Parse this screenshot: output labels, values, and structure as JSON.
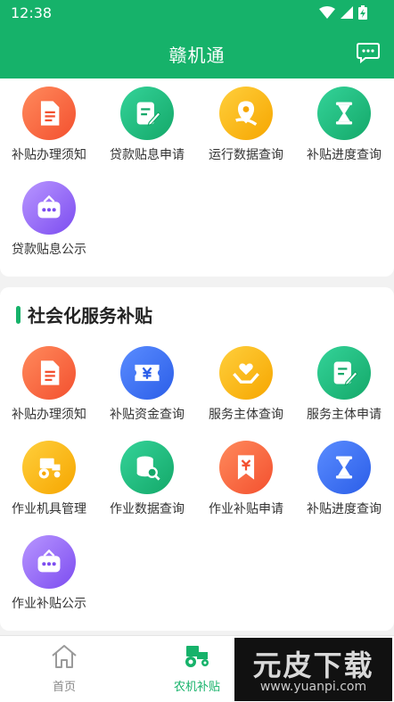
{
  "status_bar": {
    "time": "12:38"
  },
  "header": {
    "title": "赣机通"
  },
  "section1": {
    "items": [
      {
        "label": "补贴办理须知",
        "icon": "document-icon",
        "color": "orange"
      },
      {
        "label": "贷款贴息申请",
        "icon": "edit-form-icon",
        "color": "green"
      },
      {
        "label": "运行数据查询",
        "icon": "location-pin-icon",
        "color": "yellow"
      },
      {
        "label": "补贴进度查询",
        "icon": "hourglass-icon",
        "color": "green"
      },
      {
        "label": "贷款贴息公示",
        "icon": "notice-board-icon",
        "color": "purple"
      }
    ]
  },
  "section2": {
    "title": "社会化服务补贴",
    "items": [
      {
        "label": "补贴办理须知",
        "icon": "document-icon",
        "color": "orange"
      },
      {
        "label": "补贴资金查询",
        "icon": "yuan-ticket-icon",
        "color": "blue"
      },
      {
        "label": "服务主体查询",
        "icon": "heart-hands-icon",
        "color": "yellow"
      },
      {
        "label": "服务主体申请",
        "icon": "edit-form-icon",
        "color": "green"
      },
      {
        "label": "作业机具管理",
        "icon": "tractor-icon",
        "color": "yellow"
      },
      {
        "label": "作业数据查询",
        "icon": "database-search-icon",
        "color": "green"
      },
      {
        "label": "作业补贴申请",
        "icon": "yuan-bookmark-icon",
        "color": "orange"
      },
      {
        "label": "补贴进度查询",
        "icon": "hourglass-icon",
        "color": "blue"
      },
      {
        "label": "作业补贴公示",
        "icon": "notice-board-icon",
        "color": "purple"
      }
    ]
  },
  "tabbar": {
    "home_label": "首页",
    "subsidy_label": "农机补贴",
    "active_color": "#16b26a"
  },
  "watermark": {
    "text": "元皮下载",
    "url": "www.yuanpi.com"
  }
}
